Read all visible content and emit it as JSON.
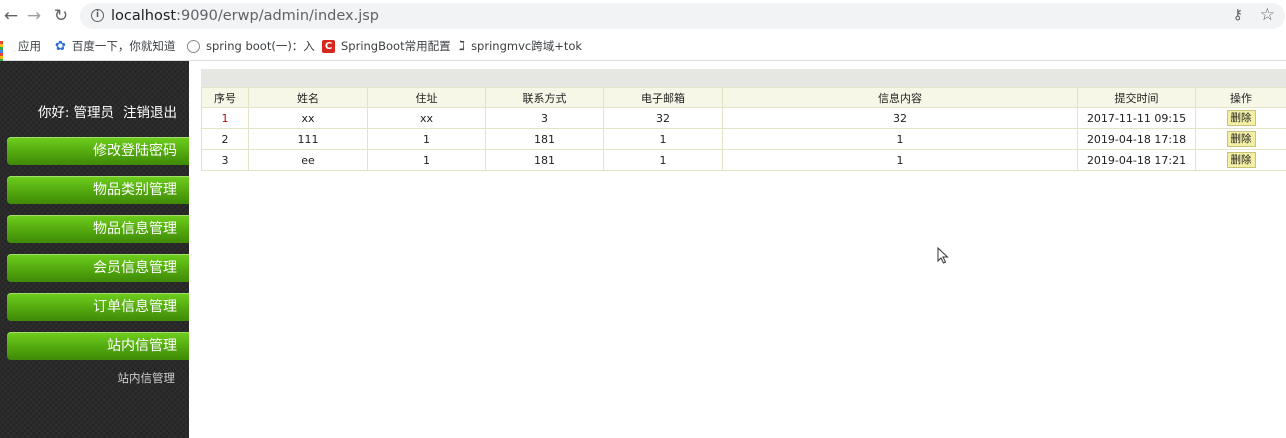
{
  "browser": {
    "back_icon": "arrow-left-icon",
    "forward_icon": "arrow-right-icon",
    "reload_icon": "reload-icon",
    "url_host": "localhost",
    "url_rest": ":9090/erwp/admin/index.jsp",
    "bookmarks": [
      {
        "label": "应用",
        "icon": "apps-icon"
      },
      {
        "label": "百度一下，你就知道",
        "icon": "paw-icon"
      },
      {
        "label": "spring boot(一)：入",
        "icon": "globe-icon"
      },
      {
        "label": "SpringBoot常用配置",
        "icon": "c-logo-icon"
      },
      {
        "label": "springmvc跨域+tok",
        "icon": "spring-icon"
      }
    ]
  },
  "sidebar": {
    "greeting": "你好:",
    "user": "管理员",
    "logout": "注销退出",
    "menu": [
      "修改登陆密码",
      "物品类别管理",
      "物品信息管理",
      "会员信息管理",
      "订单信息管理",
      "站内信管理"
    ],
    "submenu": "站内信管理"
  },
  "table": {
    "columns": [
      "序号",
      "姓名",
      "住址",
      "联系方式",
      "电子邮箱",
      "信息内容",
      "提交时间",
      "操作"
    ],
    "rows": [
      [
        "1",
        "xx",
        "xx",
        "3",
        "32",
        "32",
        "2017-11-11 09:15"
      ],
      [
        "2",
        "111",
        "1",
        "181",
        "1",
        "1",
        "2019-04-18 17:18"
      ],
      [
        "3",
        "ee",
        "1",
        "181",
        "1",
        "1",
        "2019-04-18 17:21"
      ]
    ],
    "delete_label": "删除"
  },
  "colors": {
    "menu_green": "#52a80e",
    "sidebar_bg": "#2a2a2a",
    "delete_bg": "#f3efa4"
  }
}
